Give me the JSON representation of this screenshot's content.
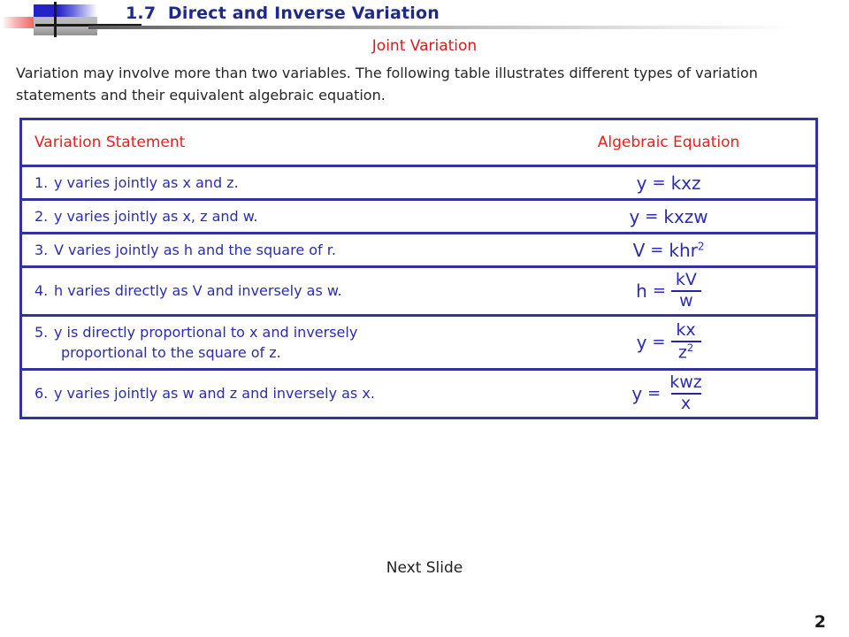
{
  "slide": {
    "title": "1.7  Direct and Inverse Variation",
    "subtitle": "Joint Variation",
    "intro": "Variation may involve more than two variables.  The following table illustrates different types of variation statements and their equivalent algebraic equation.",
    "next_slide_label": "Next Slide",
    "page_number": "2"
  },
  "colors": {
    "title_blue": "#1f2a86",
    "accent_red": "#d81c1c",
    "header_red": "#ee1c1c",
    "table_border_blue": "#3333a0",
    "body_blue": "#2b2bb5",
    "equation_blue": "#26269e"
  },
  "table": {
    "headers": {
      "statement": "Variation Statement",
      "equation": "Algebraic Equation"
    },
    "rows": [
      {
        "number": "1.",
        "statement": "y varies jointly as x and z.",
        "statement_line2": "",
        "equation": {
          "lhs": "y",
          "rel": "=",
          "type": "inline",
          "rhs": "kxz",
          "numerator": "",
          "denominator": "",
          "denominator_exp": "",
          "rhs_exp": ""
        }
      },
      {
        "number": "2.",
        "statement": "y varies jointly as x, z and w.",
        "statement_line2": "",
        "equation": {
          "lhs": "y",
          "rel": "=",
          "type": "inline",
          "rhs": "kxzw",
          "numerator": "",
          "denominator": "",
          "denominator_exp": "",
          "rhs_exp": ""
        }
      },
      {
        "number": "3.",
        "statement": "V varies jointly as h and the square of r.",
        "statement_line2": "",
        "equation": {
          "lhs": "V",
          "rel": "=",
          "type": "inline",
          "rhs": "khr",
          "numerator": "",
          "denominator": "",
          "denominator_exp": "",
          "rhs_exp": "2"
        }
      },
      {
        "number": "4.",
        "statement": "h varies directly as V and inversely as w.",
        "statement_line2": "",
        "equation": {
          "lhs": "h",
          "rel": "=",
          "type": "fraction",
          "rhs": "",
          "numerator": "kV",
          "denominator": "w",
          "denominator_exp": "",
          "rhs_exp": ""
        }
      },
      {
        "number": "5.",
        "statement": "y is directly proportional to x and inversely",
        "statement_line2": "proportional to the square of z.",
        "equation": {
          "lhs": "y",
          "rel": "=",
          "type": "fraction",
          "rhs": "",
          "numerator": "kx",
          "denominator": "z",
          "denominator_exp": "2",
          "rhs_exp": ""
        }
      },
      {
        "number": "6.",
        "statement": "y varies jointly as w and z and inversely as x.",
        "statement_line2": "",
        "equation": {
          "lhs": "y",
          "rel": "=",
          "type": "fraction",
          "rhs": "",
          "numerator": "kwz",
          "denominator": "x",
          "denominator_exp": "",
          "rhs_exp": ""
        }
      }
    ]
  }
}
